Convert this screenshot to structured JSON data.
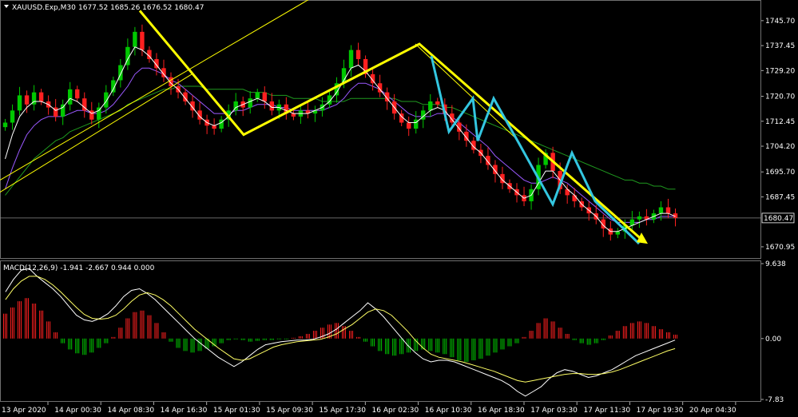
{
  "main_header": {
    "symbol": "XAUUSD.Exp,M30",
    "ohlc": "1677.52 1685.26 1676.52 1680.47"
  },
  "macd_header": {
    "label": "MACD(12,26,9) -1.941 -2.667 0.944 0.000"
  },
  "colors": {
    "background": "#000000",
    "bull": "#00c800",
    "bear": "#ff2020",
    "yellow": "#ffff00",
    "cyan": "#33c6e0",
    "ma_white": "#ffffff",
    "ma_violet": "#9b59ff",
    "ma_green": "#1f9a1f",
    "macd_line": "#ffffff",
    "signal_line": "#ffff66"
  },
  "chart_data": [
    {
      "type": "candlestick",
      "title": "XAUUSD.Exp,M30",
      "ylim": [
        1667.5,
        1752
      ],
      "y_ticks": [
        "1745.70",
        "1737.45",
        "1729.20",
        "1720.70",
        "1712.45",
        "1704.20",
        "1695.70",
        "1687.45",
        "1670.95"
      ],
      "y_tick_values": [
        1745.7,
        1737.45,
        1729.2,
        1720.7,
        1712.45,
        1704.2,
        1695.7,
        1687.45,
        1670.95
      ],
      "current_price": "1680.47",
      "current_price_value": 1680.47,
      "x_labels": [
        "13 Apr 2020",
        "14 Apr 00:30",
        "14 Apr 08:30",
        "14 Apr 16:30",
        "15 Apr 01:30",
        "15 Apr 09:30",
        "15 Apr 17:30",
        "16 Apr 02:30",
        "16 Apr 10:30",
        "16 Apr 18:30",
        "17 Apr 03:30",
        "17 Apr 11:30",
        "17 Apr 19:30",
        "20 Apr 04:30"
      ],
      "closes": [
        1712,
        1716,
        1721,
        1718,
        1722,
        1719,
        1717,
        1714,
        1718,
        1723,
        1720,
        1716,
        1713,
        1717,
        1722,
        1726,
        1731,
        1737,
        1742,
        1736,
        1733,
        1730,
        1727,
        1724,
        1722,
        1719,
        1716,
        1713,
        1711,
        1710,
        1713,
        1716,
        1719,
        1717,
        1720,
        1722,
        1719,
        1716,
        1718,
        1715,
        1714,
        1716,
        1715,
        1716,
        1718,
        1721,
        1725,
        1730,
        1736,
        1733,
        1728,
        1725,
        1722,
        1719,
        1715,
        1712,
        1710,
        1713,
        1716,
        1719,
        1718,
        1715,
        1712,
        1709,
        1706,
        1703,
        1701,
        1698,
        1695,
        1692,
        1690,
        1688,
        1686,
        1690,
        1698,
        1702,
        1696,
        1690,
        1688,
        1686,
        1684,
        1682,
        1680,
        1677,
        1675,
        1676,
        1678,
        1680,
        1681,
        1680,
        1682,
        1684,
        1682,
        1680.5
      ],
      "ma_fast": [
        1700,
        1708,
        1714,
        1717,
        1719,
        1719,
        1718,
        1716,
        1717,
        1720,
        1719,
        1717,
        1715,
        1716,
        1719,
        1723,
        1728,
        1733,
        1737,
        1736,
        1734,
        1731,
        1728,
        1725,
        1723,
        1720,
        1717,
        1714,
        1712,
        1711,
        1712,
        1714,
        1717,
        1718,
        1719,
        1720,
        1719,
        1717,
        1717,
        1716,
        1715,
        1715,
        1715,
        1716,
        1717,
        1719,
        1722,
        1726,
        1730,
        1731,
        1729,
        1726,
        1723,
        1720,
        1717,
        1714,
        1712,
        1712,
        1714,
        1716,
        1717,
        1716,
        1713,
        1710,
        1707,
        1704,
        1702,
        1699,
        1696,
        1693,
        1691,
        1689,
        1687,
        1688,
        1692,
        1696,
        1696,
        1693,
        1690,
        1688,
        1685,
        1683,
        1681,
        1678,
        1676,
        1676,
        1677,
        1678,
        1679,
        1680,
        1681,
        1682,
        1682,
        1681
      ],
      "ma_mid": [
        1690,
        1697,
        1703,
        1708,
        1711,
        1713,
        1714,
        1714,
        1714,
        1715,
        1716,
        1716,
        1715,
        1715,
        1716,
        1718,
        1721,
        1724,
        1728,
        1730,
        1730,
        1729,
        1728,
        1726,
        1725,
        1723,
        1721,
        1719,
        1717,
        1715,
        1715,
        1715,
        1716,
        1716,
        1717,
        1718,
        1718,
        1718,
        1717,
        1717,
        1716,
        1716,
        1716,
        1716,
        1716,
        1717,
        1718,
        1720,
        1723,
        1725,
        1725,
        1724,
        1723,
        1721,
        1719,
        1717,
        1715,
        1714,
        1714,
        1714,
        1715,
        1715,
        1714,
        1712,
        1710,
        1708,
        1706,
        1704,
        1701,
        1699,
        1697,
        1695,
        1693,
        1692,
        1692,
        1693,
        1694,
        1693,
        1692,
        1690,
        1688,
        1686,
        1684,
        1682,
        1680,
        1679,
        1679,
        1679,
        1679,
        1680,
        1680,
        1681,
        1681,
        1681
      ],
      "ma_slow": [
        1688,
        1691,
        1694,
        1697,
        1700,
        1702,
        1704,
        1706,
        1707,
        1709,
        1710,
        1711,
        1712,
        1713,
        1714,
        1715,
        1716,
        1718,
        1719,
        1720,
        1721,
        1722,
        1723,
        1723,
        1724,
        1724,
        1724,
        1724,
        1723,
        1723,
        1723,
        1723,
        1723,
        1723,
        1722,
        1722,
        1722,
        1721,
        1721,
        1721,
        1720,
        1720,
        1720,
        1720,
        1719,
        1719,
        1719,
        1719,
        1720,
        1720,
        1720,
        1720,
        1720,
        1720,
        1720,
        1719,
        1719,
        1719,
        1718,
        1718,
        1718,
        1717,
        1717,
        1716,
        1715,
        1714,
        1713,
        1712,
        1711,
        1710,
        1709,
        1708,
        1707,
        1706,
        1705,
        1704,
        1703,
        1702,
        1701,
        1700,
        1699,
        1698,
        1697,
        1696,
        1695,
        1694,
        1693,
        1693,
        1692,
        1692,
        1691,
        1691,
        1690,
        1690
      ],
      "yellow_lines": [
        {
          "x": [
            0,
            395
          ],
          "y": [
            1693,
            1754
          ]
        },
        {
          "x": [
            0,
            240
          ],
          "y": [
            1689,
            1728
          ]
        },
        {
          "x": [
            175,
            305,
            525,
            805
          ],
          "y": [
            1749,
            1708,
            1738,
            1673
          ]
        },
        {
          "x": [
            520,
            645
          ],
          "y": [
            1738,
            1707
          ]
        }
      ],
      "cyan_lines": [
        {
          "x": [
            540,
            562,
            592,
            598,
            618,
            650,
            692,
            716,
            745,
            800
          ],
          "y": [
            1734,
            1709,
            1720,
            1706,
            1720,
            1705,
            1685,
            1702,
            1686,
            1672
          ]
        }
      ]
    },
    {
      "type": "bar",
      "title": "MACD(12,26,9) -1.941 -2.667 0.944 0.000",
      "ylim": [
        -7.83,
        9.638
      ],
      "y_ticks": [
        "9.638",
        "0.00",
        "-7.83"
      ],
      "y_tick_values": [
        9.638,
        0,
        -7.83
      ],
      "histogram": [
        3.2,
        4.0,
        4.8,
        5.2,
        4.5,
        3.6,
        2.2,
        0.8,
        -0.6,
        -1.4,
        -1.9,
        -2.1,
        -1.8,
        -1.2,
        -0.6,
        0.2,
        1.4,
        2.6,
        3.4,
        3.6,
        3.0,
        2.0,
        0.8,
        -0.4,
        -1.2,
        -1.6,
        -1.8,
        -1.6,
        -1.3,
        -1.0,
        -0.6,
        -0.2,
        -0.1,
        -0.2,
        -0.4,
        -0.3,
        -0.2,
        -0.2,
        -0.1,
        -0.1,
        0.1,
        0.3,
        0.6,
        1.0,
        1.4,
        1.8,
        2.0,
        1.6,
        1.0,
        0.2,
        -0.4,
        -1.0,
        -1.6,
        -2.0,
        -2.2,
        -2.0,
        -1.8,
        -1.6,
        -1.4,
        -1.6,
        -1.8,
        -2.0,
        -2.4,
        -2.8,
        -3.0,
        -2.8,
        -2.6,
        -2.2,
        -1.8,
        -1.4,
        -1.0,
        -0.6,
        0.2,
        1.0,
        2.0,
        2.6,
        2.2,
        1.4,
        0.6,
        -0.2,
        -0.6,
        -0.8,
        -0.6,
        -0.2,
        0.4,
        1.0,
        1.6,
        2.0,
        2.2,
        2.0,
        1.6,
        1.2,
        0.8,
        0.5
      ],
      "macd_line": [
        6.0,
        7.6,
        8.8,
        9.0,
        8.0,
        7.2,
        6.4,
        5.4,
        4.2,
        3.0,
        2.4,
        2.2,
        2.6,
        3.2,
        4.2,
        5.4,
        6.2,
        6.4,
        5.8,
        5.0,
        4.0,
        3.0,
        2.0,
        1.0,
        0.0,
        -0.8,
        -1.6,
        -2.4,
        -3.0,
        -3.6,
        -3.0,
        -2.2,
        -1.4,
        -0.8,
        -0.6,
        -0.4,
        -0.3,
        -0.2,
        -0.2,
        -0.1,
        0.2,
        0.6,
        1.2,
        2.0,
        2.8,
        3.6,
        4.6,
        3.8,
        2.8,
        1.6,
        0.4,
        -0.8,
        -1.8,
        -2.6,
        -3.0,
        -2.8,
        -2.8,
        -3.0,
        -3.4,
        -3.8,
        -4.2,
        -4.6,
        -5.0,
        -5.4,
        -6.0,
        -6.8,
        -7.4,
        -6.8,
        -6.2,
        -5.2,
        -4.4,
        -4.0,
        -4.2,
        -4.6,
        -5.0,
        -4.8,
        -4.4,
        -4.0,
        -3.4,
        -2.8,
        -2.2,
        -1.8,
        -1.4,
        -1.0,
        -0.6,
        -0.2
      ],
      "signal_line": [
        5.0,
        6.4,
        7.4,
        8.0,
        8.0,
        7.6,
        6.9,
        6.0,
        5.0,
        4.0,
        3.1,
        2.6,
        2.5,
        2.6,
        3.0,
        3.8,
        4.8,
        5.6,
        5.9,
        5.6,
        5.0,
        4.2,
        3.2,
        2.2,
        1.2,
        0.4,
        -0.4,
        -1.2,
        -1.9,
        -2.6,
        -2.8,
        -2.6,
        -2.1,
        -1.6,
        -1.1,
        -0.8,
        -0.6,
        -0.4,
        -0.3,
        -0.2,
        -0.1,
        0.2,
        0.6,
        1.2,
        1.8,
        2.6,
        3.4,
        3.8,
        3.6,
        3.0,
        2.0,
        1.0,
        -0.2,
        -1.2,
        -2.0,
        -2.4,
        -2.6,
        -2.8,
        -3.0,
        -3.3,
        -3.6,
        -3.9,
        -4.2,
        -4.6,
        -5.0,
        -5.4,
        -5.6,
        -5.4,
        -5.2,
        -5.0,
        -4.8,
        -4.6,
        -4.5,
        -4.5,
        -4.6,
        -4.6,
        -4.5,
        -4.3,
        -4.0,
        -3.6,
        -3.2,
        -2.8,
        -2.4,
        -2.0,
        -1.6,
        -1.3
      ]
    }
  ]
}
